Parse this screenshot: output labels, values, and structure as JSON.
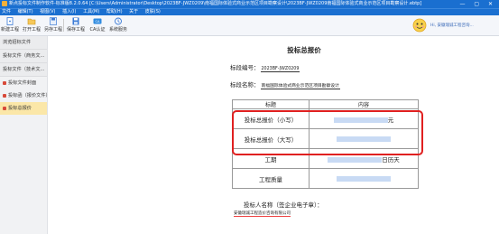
{
  "titlebar": {
    "text": "新点投标文件制作软件-标准版8.2.0.64  [C:\\Users\\Administrator\\Desktop\\2023BF-JWZ0209\\南福国际体验式商业示范区项目勘察设计\\2023BF-JWZ0209南福国际体验式商业示范区项目勘察设计.ebtp]",
    "window_controls": "— ▢ ✕"
  },
  "menubar": {
    "items": [
      "文件",
      "编辑(T)",
      "视图(V)",
      "插入(I)",
      "工具(M)",
      "帮助(H)",
      "关于",
      "皮肤(S)"
    ]
  },
  "toolbar": {
    "buttons": [
      {
        "label": "新建工程"
      },
      {
        "label": "打开工程"
      },
      {
        "label": "另存工程"
      },
      {
        "label": "保存工程"
      },
      {
        "label": "CA认证"
      },
      {
        "label": "系统服务"
      }
    ],
    "user_label": "Hi, 安徽瑞诚工程咨询..."
  },
  "sidebar": {
    "groups": [
      {
        "label": "浏览招标文件"
      },
      {
        "label": "投标文件（商务文..."
      },
      {
        "label": "投标文件（技术文..."
      }
    ],
    "items": [
      {
        "label": "投标文件封面"
      },
      {
        "label": "投标函（报价文件）"
      },
      {
        "label": "投标总报价"
      }
    ]
  },
  "document": {
    "title": "投标总报价",
    "section_number_label": "标段编号：",
    "section_number_value": "2023BF-JWZ0209",
    "section_name_label": "标段名称：",
    "section_name_value": "南福国际体验式商业示范区项目勘察设计",
    "table": {
      "header_title": "标题",
      "header_content": "内容",
      "rows": [
        {
          "title": "投标总报价（小写）",
          "suffix": "元"
        },
        {
          "title": "投标总报价（大写）",
          "suffix": ""
        },
        {
          "title": "工期",
          "suffix": "日历天"
        },
        {
          "title": "工程质量",
          "suffix": ""
        }
      ]
    },
    "bidder_label": "投标人名称（签企业电子章）：",
    "bidder_value": "安徽瑞诚工程造价咨询有限公司"
  },
  "colors": {
    "titlebar_bg": "#1a6fd0",
    "highlight_border": "#e02020",
    "active_item_bg": "#fbe7a8",
    "input_fill": "#c8daf4"
  }
}
